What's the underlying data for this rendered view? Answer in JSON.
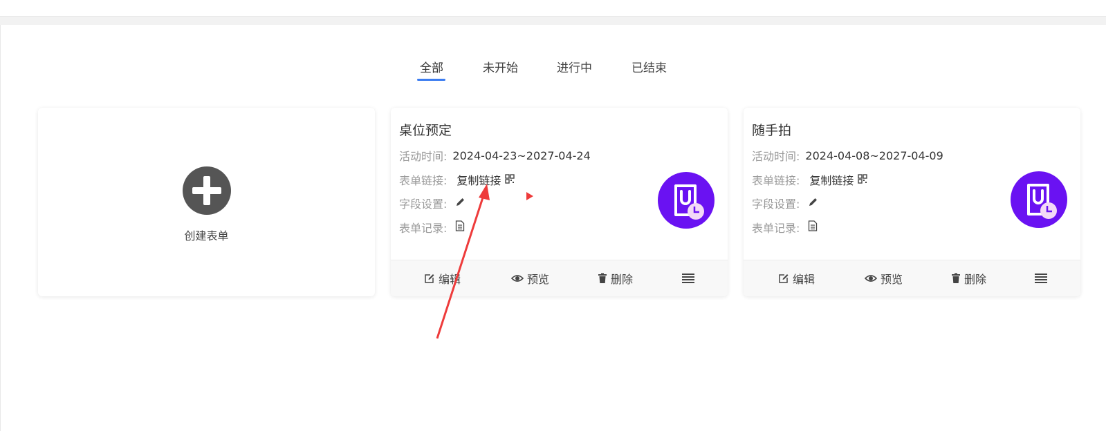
{
  "tabs": [
    {
      "label": "全部",
      "active": true
    },
    {
      "label": "未开始",
      "active": false
    },
    {
      "label": "进行中",
      "active": false
    },
    {
      "label": "已结束",
      "active": false
    }
  ],
  "create_card": {
    "label": "创建表单",
    "icon": "plus-circle-icon"
  },
  "labels": {
    "time": "活动时间:",
    "link": "表单链接:",
    "fields": "字段设置:",
    "records": "表单记录:",
    "copy_link": "复制链接"
  },
  "actions": {
    "edit": "编辑",
    "preview": "预览",
    "delete": "删除"
  },
  "forms": [
    {
      "title": "桌位预定",
      "time": "2024-04-23~2027-04-24"
    },
    {
      "title": "随手拍",
      "time": "2024-04-08~2027-04-09"
    }
  ],
  "colors": {
    "accent": "#3b7cf0",
    "avatar": "#6a12f2",
    "annotation": "#ee3b3b"
  }
}
